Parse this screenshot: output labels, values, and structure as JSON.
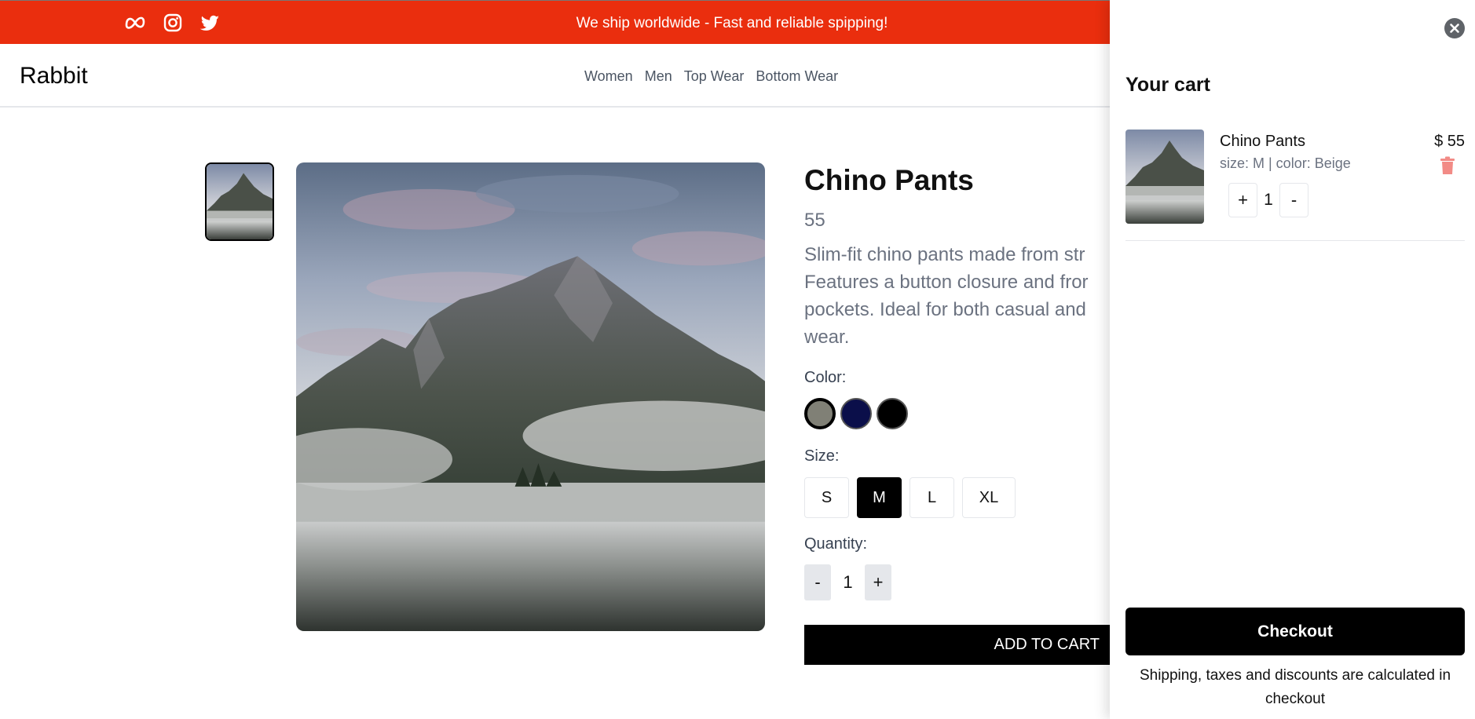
{
  "topbar": {
    "announcement": "We ship worldwide - Fast and reliable spipping!",
    "social_icons": [
      "meta-icon",
      "instagram-icon",
      "twitter-icon"
    ],
    "background": "#ea2e0e"
  },
  "header": {
    "logo": "Rabbit",
    "nav": [
      "Women",
      "Men",
      "Top Wear",
      "Bottom Wear"
    ]
  },
  "product": {
    "title": "Chino Pants",
    "price": "55",
    "description": "Slim-fit chino pants made from str\nFeatures a button closure and fror\npockets. Ideal for both casual and\nwear.",
    "color_label": "Color:",
    "colors": [
      {
        "name": "gray",
        "hex": "#808076",
        "selected": true
      },
      {
        "name": "navy",
        "hex": "#0b0f4a",
        "selected": false
      },
      {
        "name": "black",
        "hex": "#000000",
        "selected": false
      }
    ],
    "size_label": "Size:",
    "sizes": [
      "S",
      "M",
      "L",
      "XL"
    ],
    "selected_size": "M",
    "quantity_label": "Quantity:",
    "quantity": "1",
    "minus": "-",
    "plus": "+",
    "add_to_cart": "ADD TO CART"
  },
  "cart": {
    "title": "Your cart",
    "items": [
      {
        "name": "Chino Pants",
        "meta": "size: M | color: Beige",
        "price": "$ 55",
        "quantity": "1",
        "plus": "+",
        "minus": "-"
      }
    ],
    "checkout": "Checkout",
    "note": "Shipping, taxes and discounts are calculated in checkout"
  }
}
